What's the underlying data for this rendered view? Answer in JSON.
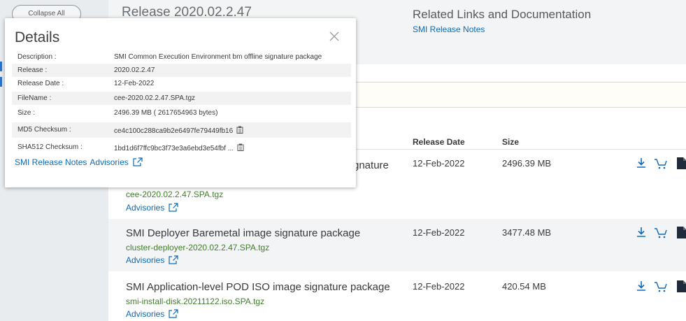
{
  "sidebar": {
    "collapse_label": "Collapse All"
  },
  "release": {
    "title": "Release 2020.02.2.47"
  },
  "related": {
    "title": "Related Links and Documentation",
    "link": "SMI Release Notes"
  },
  "table": {
    "headers": {
      "release_date": "Release Date",
      "size": "Size"
    },
    "rows": [
      {
        "name": "SMI Common Execution Environment bm offline signature package",
        "file": "cee-2020.02.2.47.SPA.tgz",
        "advisories": "Advisories",
        "date": "12-Feb-2022",
        "size": "2496.39 MB"
      },
      {
        "name": "SMI Deployer Baremetal image signature package",
        "file": "cluster-deployer-2020.02.2.47.SPA.tgz",
        "advisories": "Advisories",
        "date": "12-Feb-2022",
        "size": "3477.48 MB"
      },
      {
        "name": "SMI Application-level POD ISO image signature package",
        "file": "smi-install-disk.20211122.iso.SPA.tgz",
        "advisories": "Advisories",
        "date": "12-Feb-2022",
        "size": "420.54 MB"
      }
    ],
    "row1_visible_tail": "gnature"
  },
  "details": {
    "title": "Details",
    "rows": [
      {
        "label": "Description :",
        "value": "SMI Common Execution Environment bm offline signature package"
      },
      {
        "label": "Release :",
        "value": "2020.02.2.47"
      },
      {
        "label": "Release Date :",
        "value": "12-Feb-2022"
      },
      {
        "label": "FileName :",
        "value": "cee-2020.02.2.47.SPA.tgz"
      },
      {
        "label": "Size :",
        "value": "2496.39 MB ( 2617654963 bytes)"
      },
      {
        "label": "MD5 Checksum :",
        "value": "ce4c100c288ca9b2e6497fe79449fb16"
      },
      {
        "label": "SHA512 Checksum :",
        "value": "1bd1d6f7ffc9bc3f73e3a6ebd3e54fbf ..."
      }
    ],
    "links": {
      "release_notes": "SMI Release Notes",
      "advisories": "Advisories"
    }
  },
  "colors": {
    "link": "#0d6ab8",
    "filename": "#3f7d2a",
    "sidebar_bg": "#e9ecef",
    "alt_row_bg": "#f3f4f5"
  }
}
